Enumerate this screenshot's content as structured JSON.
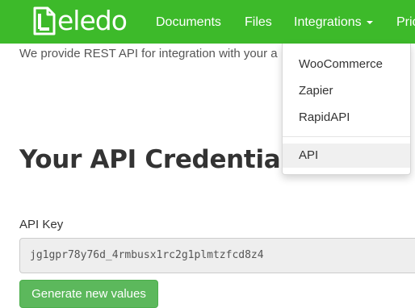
{
  "brand": {
    "logo_text": "eledo",
    "color": "#3dba2a"
  },
  "nav": {
    "items": [
      {
        "label": "Documents"
      },
      {
        "label": "Files"
      },
      {
        "label": "Integrations"
      },
      {
        "label": "Pric"
      }
    ]
  },
  "dropdown": {
    "items": [
      {
        "label": "WooCommerce"
      },
      {
        "label": "Zapier"
      },
      {
        "label": "RapidAPI"
      },
      {
        "label": "API",
        "active": true
      }
    ]
  },
  "intro": {
    "text": "We provide REST API for integration with your a"
  },
  "credentials": {
    "heading": "Your API Credentials",
    "api_key_label": "API Key",
    "api_key_value": "jg1gpr78y76d_4rmbusx1rc2g1plmtzfcd8z4",
    "generate_button": "Generate new values",
    "button_color": "#5cb85c"
  }
}
